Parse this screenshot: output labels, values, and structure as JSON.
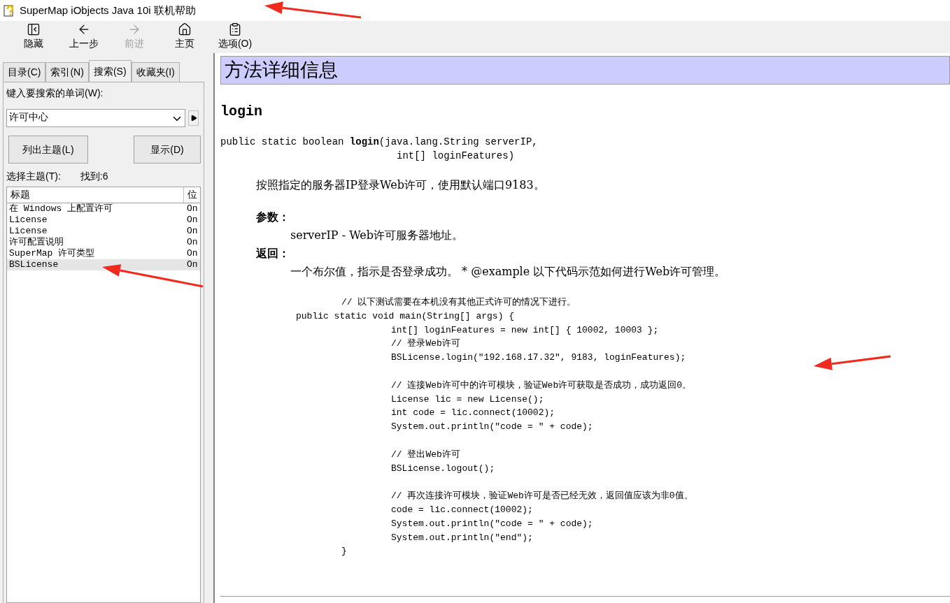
{
  "window": {
    "title": "SuperMap iObjects Java 10i 联机帮助"
  },
  "toolbar": [
    {
      "label": "隐藏",
      "kind": "hide",
      "disabled": false
    },
    {
      "label": "上一步",
      "kind": "back",
      "disabled": false
    },
    {
      "label": "前进",
      "kind": "forward",
      "disabled": true
    },
    {
      "label": "主页",
      "kind": "home",
      "disabled": false
    },
    {
      "label": "选项(O)",
      "kind": "options",
      "disabled": false
    }
  ],
  "nav_tabs": [
    {
      "label": "目录(C)",
      "selected": false
    },
    {
      "label": "索引(N)",
      "selected": false
    },
    {
      "label": "搜索(S)",
      "selected": true
    },
    {
      "label": "收藏夹(I)",
      "selected": false
    }
  ],
  "search": {
    "label": "键入要搜索的单词(W):",
    "value": "许可中心",
    "list_button": "列出主题(L)",
    "display_button": "显示(D)",
    "select_label": "选择主题(T):",
    "found": "找到:6"
  },
  "results": {
    "columns": [
      "标题",
      "位"
    ],
    "rows": [
      {
        "title": "在 Windows 上配置许可",
        "location": "On",
        "selected": false
      },
      {
        "title": "License",
        "location": "On",
        "selected": false
      },
      {
        "title": "License",
        "location": "On",
        "selected": false
      },
      {
        "title": "许可配置说明",
        "location": "On",
        "selected": false
      },
      {
        "title": "SuperMap 许可类型",
        "location": "On",
        "selected": false
      },
      {
        "title": "BSLicense",
        "location": "On",
        "selected": true
      }
    ]
  },
  "content": {
    "heading": "方法详细信息",
    "method_name": "login",
    "signature": [
      "public static boolean **login**(java.lang.String serverIP,",
      "int[] loginFeatures)"
    ],
    "description": "按照指定的服务器IP登录Web许可，使用默认端口9183。",
    "params_label": "参数：",
    "param": "serverIP - Web许可服务器地址。",
    "returns_label": "返回：",
    "returns": "一个布尔值，指示是否登录成功。 * @example 以下代码示范如何进行Web许可管理。",
    "code_lines": [
      {
        "kind": "outer",
        "text": "// 以下测试需要在本机没有其他正式许可的情况下进行。"
      },
      {
        "kind": "head",
        "text": "public static void main(String[] args) {"
      },
      {
        "kind": "inner",
        "text": "int[] loginFeatures = new int[] { 10002, 10003 };"
      },
      {
        "kind": "inner",
        "text": "// 登录Web许可"
      },
      {
        "kind": "inner",
        "text": "BSLicense.login(\"192.168.17.32\", 9183, loginFeatures);"
      },
      {
        "kind": "blank"
      },
      {
        "kind": "inner",
        "text": "// 连接Web许可中的许可模块，验证Web许可获取是否成功，成功返回0。"
      },
      {
        "kind": "inner",
        "text": "License lic = new License();"
      },
      {
        "kind": "inner",
        "text": "int code = lic.connect(10002);"
      },
      {
        "kind": "inner",
        "text": "System.out.println(\"code = \" + code);"
      },
      {
        "kind": "blank"
      },
      {
        "kind": "inner",
        "text": "// 登出Web许可"
      },
      {
        "kind": "inner",
        "text": "BSLicense.logout();"
      },
      {
        "kind": "blank"
      },
      {
        "kind": "inner",
        "text": "// 再次连接许可模块，验证Web许可是否已经无效，返回值应该为非0值。"
      },
      {
        "kind": "inner",
        "text": "code = lic.connect(10002);"
      },
      {
        "kind": "inner",
        "text": "System.out.println(\"code = \" + code);"
      },
      {
        "kind": "inner",
        "text": "System.out.println(\"end\");"
      },
      {
        "kind": "outer",
        "text": "}"
      }
    ]
  }
}
